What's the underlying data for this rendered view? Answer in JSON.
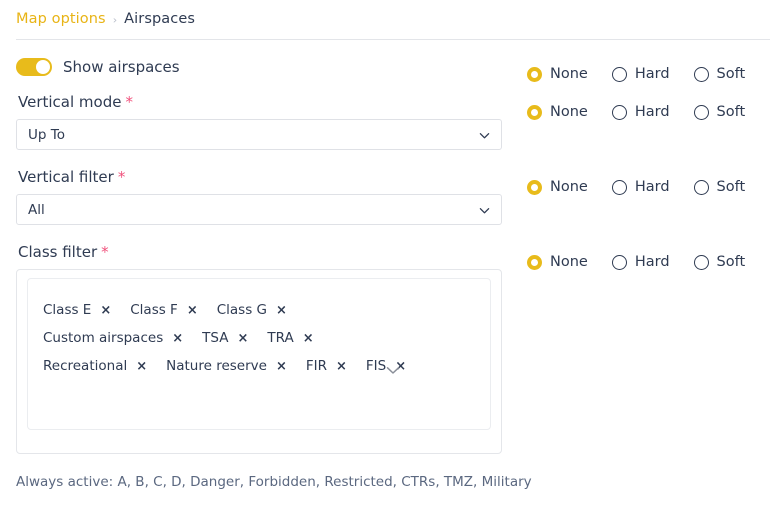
{
  "breadcrumb": {
    "parent": "Map options",
    "separator": "›",
    "current": "Airspaces"
  },
  "colors": {
    "accent": "#e8bb1b",
    "breadcrumb_link": "#e8b416",
    "text": "#2f3b52",
    "required_asterisk": "#f0537d",
    "border": "#dfe1e6",
    "helper_text": "#5b6880"
  },
  "show_airspaces": {
    "label": "Show airspaces",
    "state": "on"
  },
  "vertical_mode": {
    "label": "Vertical mode",
    "required_marker": "*",
    "value": "Up To"
  },
  "vertical_filter": {
    "label": "Vertical filter",
    "required_marker": "*",
    "value": "All"
  },
  "class_filter": {
    "label": "Class filter",
    "required_marker": "*",
    "remove_glyph": "×",
    "tags": [
      "Class E",
      "Class F",
      "Class G",
      "Custom airspaces",
      "TSA",
      "TRA",
      "Recreational",
      "Nature reserve",
      "FIR",
      "FIS"
    ],
    "helper_text": "Always active: A, B, C, D, Danger, Forbidden, Restricted, CTRs, TMZ, Military"
  },
  "radio_groups": [
    {
      "id": "show-airspaces-options",
      "options": [
        "None",
        "Hard",
        "Soft"
      ],
      "selected": "None"
    },
    {
      "id": "vertical-mode-options",
      "options": [
        "None",
        "Hard",
        "Soft"
      ],
      "selected": "None"
    },
    {
      "id": "vertical-filter-options",
      "options": [
        "None",
        "Hard",
        "Soft"
      ],
      "selected": "None"
    },
    {
      "id": "class-filter-options",
      "options": [
        "None",
        "Hard",
        "Soft"
      ],
      "selected": "None"
    }
  ]
}
